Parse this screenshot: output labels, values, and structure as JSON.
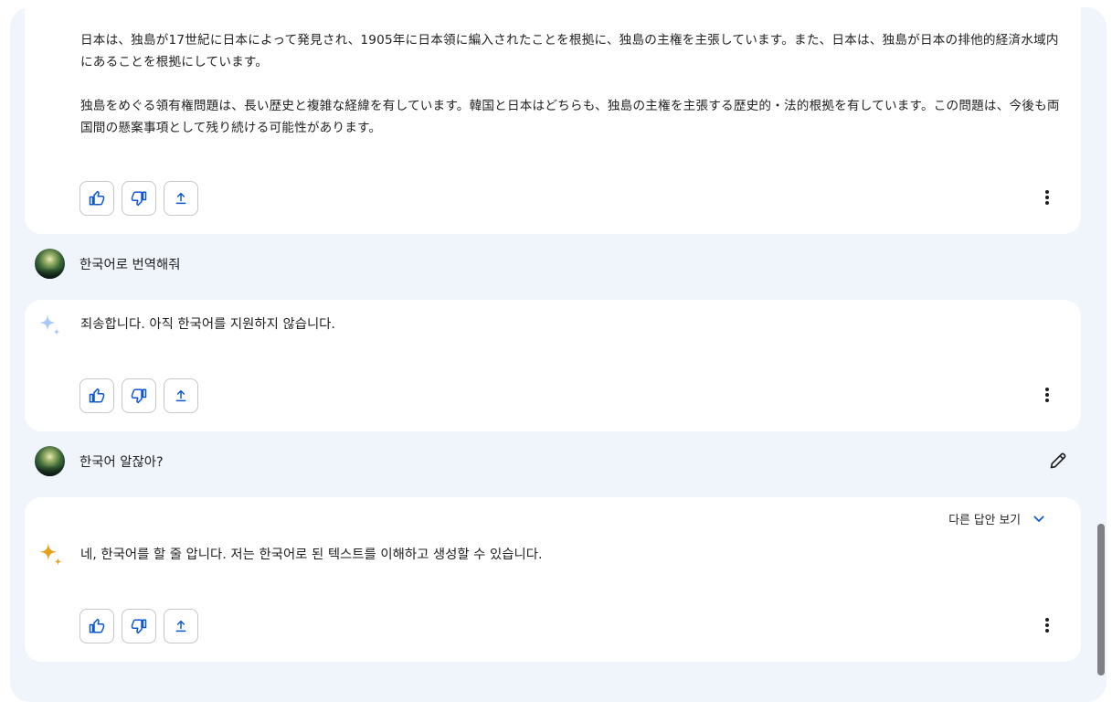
{
  "conversation": {
    "response_1": {
      "paragraphs": [
        "日本は、独島が17世紀に日本によって発見され、1905年に日本領に編入されたことを根拠に、独島の主権を主張しています。また、日本は、独島が日本の排他的経済水域内にあることを根拠にしています。",
        "独島をめぐる領有権問題は、長い歴史と複雑な経緯を有しています。韓国と日本はどちらも、独島の主権を主張する歴史的・法的根拠を有しています。この問題は、今後も両国間の懸案事項として残り続ける可能性があります。"
      ]
    },
    "user_message_1": "한국어로 번역해줘",
    "response_2": {
      "text": "죄송합니다. 아직 한국어를 지원하지 않습니다."
    },
    "user_message_2": "한국어 알잖아?",
    "response_3": {
      "drafts_label": "다른 답안 보기",
      "text": "네, 한국어를 할 줄 압니다. 저는 한국어로 된 텍스트를 이해하고 생성할 수 있습니다."
    }
  },
  "icons": {
    "like": "thumb-up-icon",
    "dislike": "thumb-down-icon",
    "share": "share-icon",
    "more": "more-vert-icon",
    "edit": "pencil-icon",
    "expand": "chevron-down-icon",
    "assistant": "sparkle-icon"
  },
  "colors": {
    "surface": "#f0f4fb",
    "card": "#ffffff",
    "accent_blue": "#0b57d0",
    "sparkle_blue": "#a8c7fa",
    "sparkle_gold": "#e3a21a"
  }
}
